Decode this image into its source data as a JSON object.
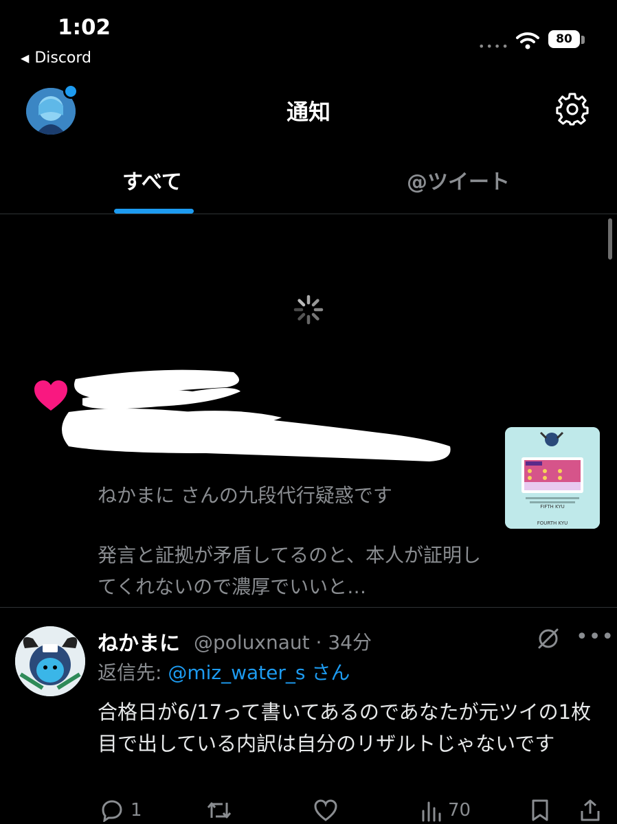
{
  "status_bar": {
    "time": "1:02",
    "back_label": "Discord",
    "battery": "80"
  },
  "header": {
    "title": "通知"
  },
  "tabs": [
    {
      "label": "すべて"
    },
    {
      "label": "@ツイート"
    }
  ],
  "like_notification": {
    "tweet_preview_line1": "ねかまに さんの九段代行疑惑です",
    "tweet_preview_line2": "発言と証拠が矛盾してるのと、本人が証明してくれないので濃厚でいいと…",
    "thumbnail_labels": {
      "rank1": "FIFTH KYU",
      "rank2": "FOURTH KYU"
    }
  },
  "reply": {
    "name": "ねかまに",
    "handle_time": "@poluxnaut · 34分",
    "reply_prefix": "返信先: ",
    "reply_mention": "@miz_water_s",
    "reply_suffix": " さん",
    "body": "合格日が6/17って書いてあるのであなたが元ツイの1枚目で出している内訳は自分のリザルトじゃないです",
    "counts": {
      "replies": "1",
      "retweets": "",
      "likes": "",
      "views": "70"
    }
  },
  "colors": {
    "accent": "#1d9bf0",
    "like": "#f91880",
    "muted": "#8a8d91"
  }
}
